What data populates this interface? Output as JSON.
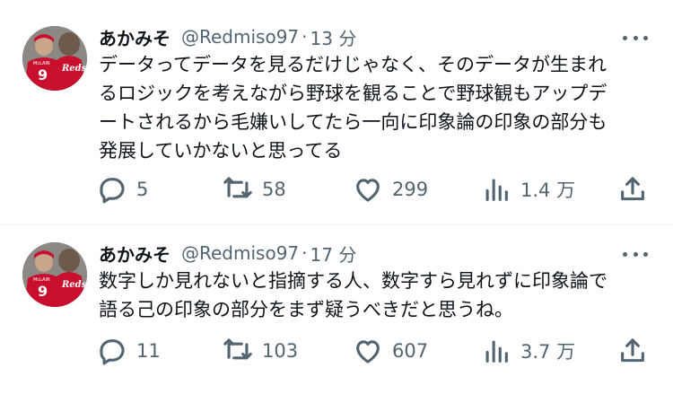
{
  "colors": {
    "text": "#0f1419",
    "secondary": "#536471",
    "divider": "#eff3f4",
    "jersey_red": "#c8102e"
  },
  "avatar": {
    "jersey_text": "Reds",
    "jersey_name": "McLAIN",
    "jersey_number": "9"
  },
  "tweets": [
    {
      "author": {
        "name": "あかみそ",
        "handle": "@Redmiso97"
      },
      "separator": "·",
      "time": "13 分",
      "text_lines": [
        "データってデータを見るだけじゃなく、そのデータが生まれ",
        "るロジックを考えながら野球を観ることで野球観もアップデ",
        "ートされるから毛嫌いしてたら一向に印象論の印象の部分も",
        "発展していかないと思ってる"
      ],
      "stats": {
        "replies": "5",
        "retweets": "58",
        "likes": "299",
        "views": "1.4 万"
      },
      "icons": {
        "reply": "reply-icon",
        "retweet": "retweet-icon",
        "like": "heart-icon",
        "views": "views-chart-icon",
        "share": "share-icon",
        "more": "more-icon"
      }
    },
    {
      "author": {
        "name": "あかみそ",
        "handle": "@Redmiso97"
      },
      "separator": "·",
      "time": "17 分",
      "text_lines": [
        "数字しか見れないと指摘する人、数字すら見れずに印象論で",
        "語る己の印象の部分をまず疑うべきだと思うね。"
      ],
      "stats": {
        "replies": "11",
        "retweets": "103",
        "likes": "607",
        "views": "3.7 万"
      },
      "icons": {
        "reply": "reply-icon",
        "retweet": "retweet-icon",
        "like": "heart-icon",
        "views": "views-chart-icon",
        "share": "share-icon",
        "more": "more-icon"
      }
    }
  ]
}
